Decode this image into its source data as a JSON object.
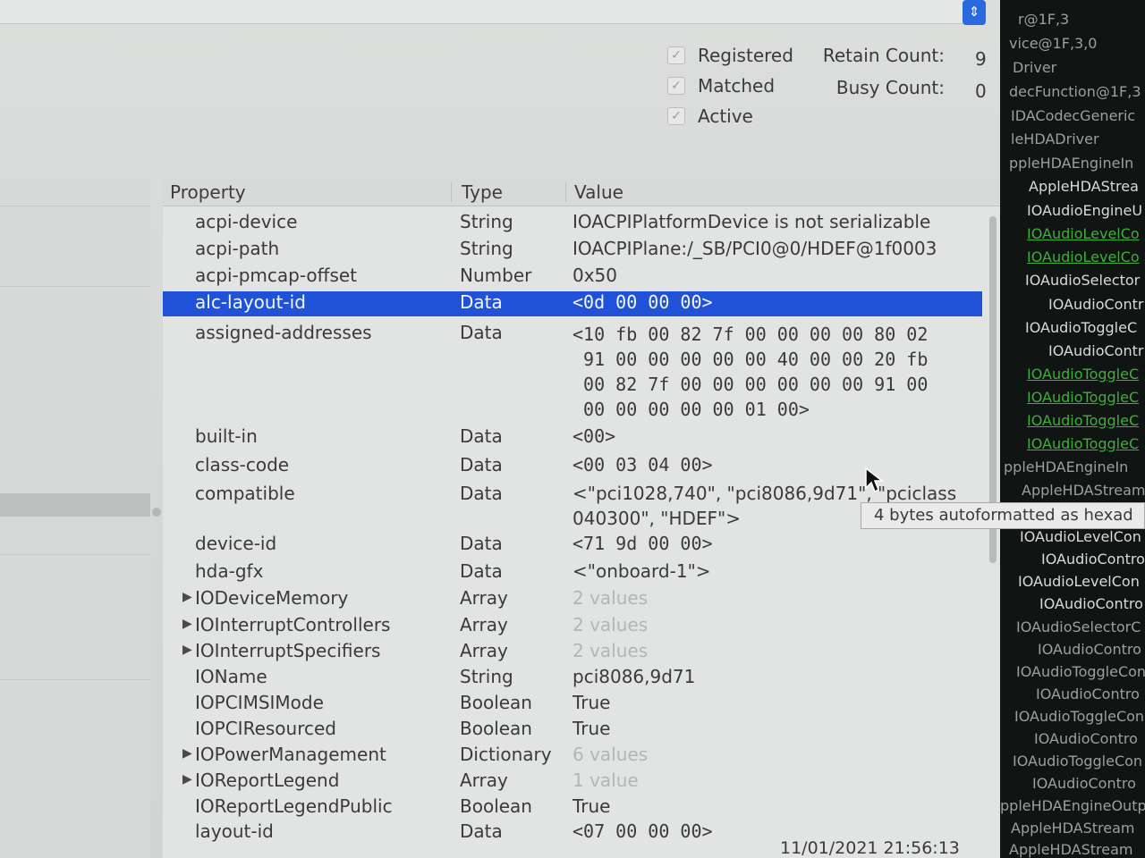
{
  "status": {
    "checkboxes": [
      {
        "label": "Registered",
        "checked": true
      },
      {
        "label": "Matched",
        "checked": true
      },
      {
        "label": "Active",
        "checked": true
      }
    ],
    "retain_count_label": "Retain Count:",
    "retain_count_value": "9",
    "busy_count_label": "Busy Count:",
    "busy_count_value": "0"
  },
  "table": {
    "headers": {
      "property": "Property",
      "type": "Type",
      "value": "Value"
    },
    "rows": [
      {
        "property": "acpi-device",
        "type": "String",
        "value": "IOACPIPlatformDevice is not serializable"
      },
      {
        "property": "acpi-path",
        "type": "String",
        "value": "IOACPIPlane:/_SB/PCI0@0/HDEF@1f0003"
      },
      {
        "property": "acpi-pmcap-offset",
        "type": "Number",
        "value": "0x50"
      },
      {
        "property": "alc-layout-id",
        "type": "Data",
        "value": "<0d 00 00 00>"
      },
      {
        "property": "assigned-addresses",
        "type": "Data",
        "value": "<10 fb 00 82 7f 00 00 00 00 80 02\n 91 00 00 00 00 00 40 00 00 20 fb\n 00 82 7f 00 00 00 00 00 00 91 00\n 00 00 00 00 00 01 00>"
      },
      {
        "property": "built-in",
        "type": "Data",
        "value": "<00>"
      },
      {
        "property": "class-code",
        "type": "Data",
        "value": "<00 03 04 00>"
      },
      {
        "property": "compatible",
        "type": "Data",
        "value": "<\"pci1028,740\", \"pci8086,9d71\", \"pciclass",
        "value2": "040300\", \"HDEF\">"
      },
      {
        "property": "device-id",
        "type": "Data",
        "value": "<71 9d 00 00>"
      },
      {
        "property": "hda-gfx",
        "type": "Data",
        "value": "<\"onboard-1\">"
      },
      {
        "property": "IODeviceMemory",
        "type": "Array",
        "value": "2 values"
      },
      {
        "property": "IOInterruptControllers",
        "type": "Array",
        "value": "2 values"
      },
      {
        "property": "IOInterruptSpecifiers",
        "type": "Array",
        "value": "2 values"
      },
      {
        "property": "IOName",
        "type": "String",
        "value": "pci8086,9d71"
      },
      {
        "property": "IOPCIMSIMode",
        "type": "Boolean",
        "value": "True"
      },
      {
        "property": "IOPCIResourced",
        "type": "Boolean",
        "value": "True"
      },
      {
        "property": "IOPowerManagement",
        "type": "Dictionary",
        "value": "6 values"
      },
      {
        "property": "IOReportLegend",
        "type": "Array",
        "value": "1 value"
      },
      {
        "property": "IOReportLegendPublic",
        "type": "Boolean",
        "value": "True"
      },
      {
        "property": "layout-id",
        "type": "Data",
        "value": "<07 00 00 00>"
      }
    ]
  },
  "tooltip": "4 bytes autoformatted as hexad",
  "timestamp": "11/01/2021 21:56:13",
  "tree": [
    "r@1F,3",
    "vice@1F,3,0",
    "Driver",
    "decFunction@1F,3",
    "IDACodecGeneric",
    "leHDADriver",
    "ppleHDAEngineIn",
    "AppleHDAStrea",
    "IOAudioEngineU",
    "IOAudioLevelCo",
    "IOAudioLevelCo",
    "IOAudioSelector",
    "IOAudioContr",
    "IOAudioToggleC",
    "IOAudioContr",
    "IOAudioToggleC",
    "IOAudioToggleC",
    "IOAudioToggleC",
    "IOAudioToggleC",
    "ppleHDAEngineIn",
    "AppleHDAStream",
    "IOAudioLevelCon",
    "IOAudioContro",
    "IOAudioLevelCon",
    "IOAudioContro",
    "IOAudioSelectorC",
    "IOAudioContro",
    "IOAudioToggleCon",
    "IOAudioContro",
    "IOAudioToggleCon",
    "IOAudioContro",
    "IOAudioToggleCon",
    "IOAudioContro",
    "ppleHDAEngineOutp",
    "AppleHDAStream",
    "AppleHDAStream"
  ]
}
